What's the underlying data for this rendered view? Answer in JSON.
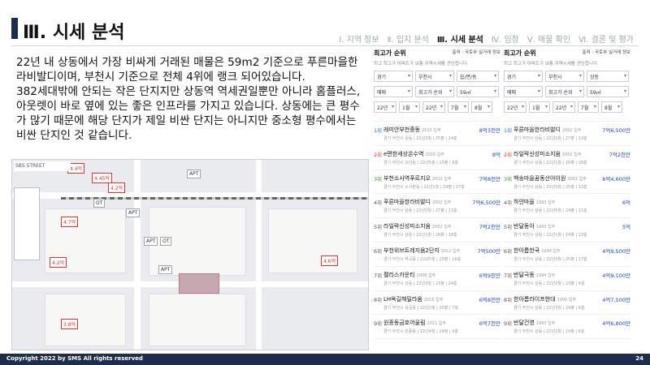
{
  "header": {
    "title": "Ⅲ. 시세 분석"
  },
  "nav": [
    "Ⅰ. 지역 정보",
    "Ⅱ. 입지 분석",
    "Ⅲ. 시세 분석",
    "Ⅳ. 임장",
    "Ⅴ. 매물 확인",
    "Ⅵ. 결론 및 평가"
  ],
  "body": {
    "p1": "22년 내 상동에서 가장 비싸게 거래된 매물은 59m2 기준으로 푸른마을한라비발디이며, 부천시 기준으로 전체 4위에 랭크 되어있습니다.",
    "p2": "382세대밖에 안되는 작은 단지지만 상동역 역세권일뿐만 아니라 홈플러스, 아웃렛이 바로 옆에 있는 좋은 인프라를 가지고 있습니다. 상동에는 큰 평수가 많기 때문에 해당 단지가 제일 비싼 단지는 아니지만 중소형 평수에서는 비싼 단지인 것 같습니다."
  },
  "map": {
    "top_label": "SBS STREET",
    "markers": [
      "4.4억",
      "4.45억",
      "4.2억",
      "4.7억",
      "APT",
      "OT",
      "APT",
      "OT",
      "4.2억",
      "4.6억",
      "3.8억",
      "APT",
      "APT"
    ]
  },
  "panels": [
    {
      "title": "최고가 순위",
      "source": "출처 : 국토부 실거래 정보",
      "sub": "최고 최고가 아파트가 보통 지역시세를 견인합니다.",
      "filters": {
        "city": "경기",
        "district": "부천시",
        "dong": "읍/면/동",
        "type": "매매",
        "order": "최고가 순위",
        "size": "59㎡",
        "y1": "22년",
        "m1": "1월",
        "y2": "22년",
        "m2": "7월",
        "m3": "8월"
      },
      "items": [
        {
          "rank": "1위",
          "name": "래미안부천중동",
          "year": "2015 입주",
          "detail": "경기 부천시 중동 | 22년3월 | 25평 | 24층",
          "price": "8억3천만"
        },
        {
          "rank": "2위",
          "name": "e편한세상온수역",
          "year": "2020 입주",
          "detail": "경기 부천시 괴안동 | 22년5월 | 25평 | 8층",
          "price": "8억"
        },
        {
          "rank": "3위",
          "name": "부천소사역푸르지오",
          "year": "2012 입주",
          "detail": "경기 부천시 소사본동 | 22년1월 | 24평 | 17층",
          "price": "7억8천만"
        },
        {
          "rank": "4위",
          "name": "푸른마을한라비발디",
          "year": "2002 입주",
          "detail": "경기 부천시 상동 | 22년2월 | 27평 | 13층",
          "price": "7억6,500만"
        },
        {
          "rank": "5위",
          "name": "라일락신성미소지움",
          "year": "2002 입주",
          "detail": "경기 부천시 상동 | 22년1월 | 26평 | 18층",
          "price": "7억2천만"
        },
        {
          "rank": "6위",
          "name": "부천위브트레지움2단지",
          "year": "2012 입주",
          "detail": "경기 부천시 역곡동 | 22년5월 | 25평 | 16층",
          "price": "7억500만"
        },
        {
          "rank": "7위",
          "name": "팰리스카운티",
          "year": "2008 입주",
          "detail": "경기 부천시 상동 | 22년3월 | 23평 | 24층",
          "price": "6억9천만"
        },
        {
          "rank": "8위",
          "name": "LH옥길해밀라움",
          "year": "2016 입주",
          "detail": "경기 부천시 옥길동 | 22년2월 | 25평 | 7층",
          "price": "6억8천만"
        },
        {
          "rank": "9위",
          "name": "원종동금호어울림",
          "year": "2011 입주",
          "detail": "경기 부천시 원종동 | 22년4월 | 24평 | 4층",
          "price": "6억7천만"
        }
      ]
    },
    {
      "title": "최고가 순위",
      "source": "출처 : 국토부 실거래 정보",
      "sub": "최고 최고가 아파트가 보통 지역시세를 견인합니다.",
      "filters": {
        "city": "경기",
        "district": "부천시",
        "dong": "상동",
        "type": "매매",
        "order": "최고가 순위",
        "size": "59㎡",
        "y1": "22년",
        "m1": "1월",
        "y2": "22년",
        "m2": "7월",
        "m3": "8월"
      },
      "items": [
        {
          "rank": "1위",
          "name": "푸른마을한라비발디",
          "year": "2002 입주",
          "detail": "경기 부천시 상동 | 22년2월 | 27평 | 13층",
          "price": "7억6,500만"
        },
        {
          "rank": "2위",
          "name": "라일락신성미소지움",
          "year": "2002 입주",
          "detail": "경기 부천시 상동 | 22년1월 | 26평 | 18층",
          "price": "7억2천만"
        },
        {
          "rank": "3위",
          "name": "백송마을꿈동산아이원",
          "year": "2001 입주",
          "detail": "경기 부천시 상동 | 22년3월 | 25평 | 12층",
          "price": "6억4,600만"
        },
        {
          "rank": "4위",
          "name": "하얀마을",
          "year": "1993 입주",
          "detail": "경기 부천시 상동 | 22년5월 | 24평 | 11층",
          "price": "6억"
        },
        {
          "rank": "5위",
          "name": "반달동아",
          "year": "1993 입주",
          "detail": "경기 부천시 상동 | 22년1월 | 24평 | 13층",
          "price": "5억"
        },
        {
          "rank": "6위",
          "name": "한아름한국",
          "year": "1994 입주",
          "detail": "경기 부천시 상동 | 22년3월 | 25평 | 17층",
          "price": "4억9,500만"
        },
        {
          "rank": "7위",
          "name": "반달극동",
          "year": "1994 입주",
          "detail": "경기 부천시 상동 | 22년2월 | 23평 | 4층",
          "price": "4억9,100만"
        },
        {
          "rank": "8위",
          "name": "한아름라이프현대",
          "year": "1995 입주",
          "detail": "경기 부천시 상동 | 22년3월 | 24평 | 6층",
          "price": "4억7,500만"
        },
        {
          "rank": "9위",
          "name": "반달건영",
          "year": "1993 입주",
          "detail": "경기 부천시 상동 | 22년2월 | 24평 | 6층",
          "price": "4억6,800만"
        }
      ]
    }
  ],
  "footer": {
    "copyright": "Copyright 2022 by SMS  All rights reserved",
    "page": "24"
  }
}
